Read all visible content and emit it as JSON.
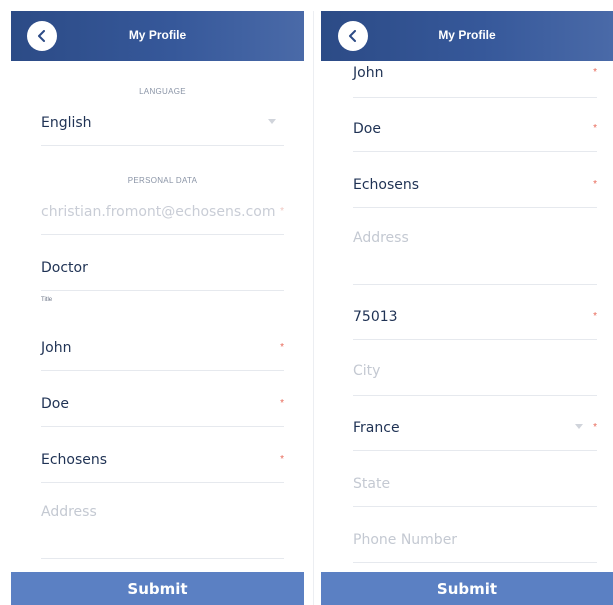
{
  "header": {
    "title": "My Profile"
  },
  "left": {
    "language_section": "LANGUAGE",
    "language_value": "English",
    "personal_section": "PERSONAL DATA",
    "email": "christian.fromont@echosens.com",
    "title_value": "Doctor",
    "title_hint": "Title",
    "first_name": "John",
    "last_name": "Doe",
    "company": "Echosens",
    "address_placeholder": "Address"
  },
  "right": {
    "first_name": "John",
    "last_name": "Doe",
    "company": "Echosens",
    "address_placeholder": "Address",
    "postal_code": "75013",
    "city_placeholder": "City",
    "country": "France",
    "state_placeholder": "State",
    "phone_placeholder": "Phone Number"
  },
  "required_marker": "*",
  "submit_label": "Submit",
  "colors": {
    "header": "#2c4b86",
    "submit": "#5b80c3",
    "required": "#e86a5a",
    "text": "#1f3254"
  }
}
